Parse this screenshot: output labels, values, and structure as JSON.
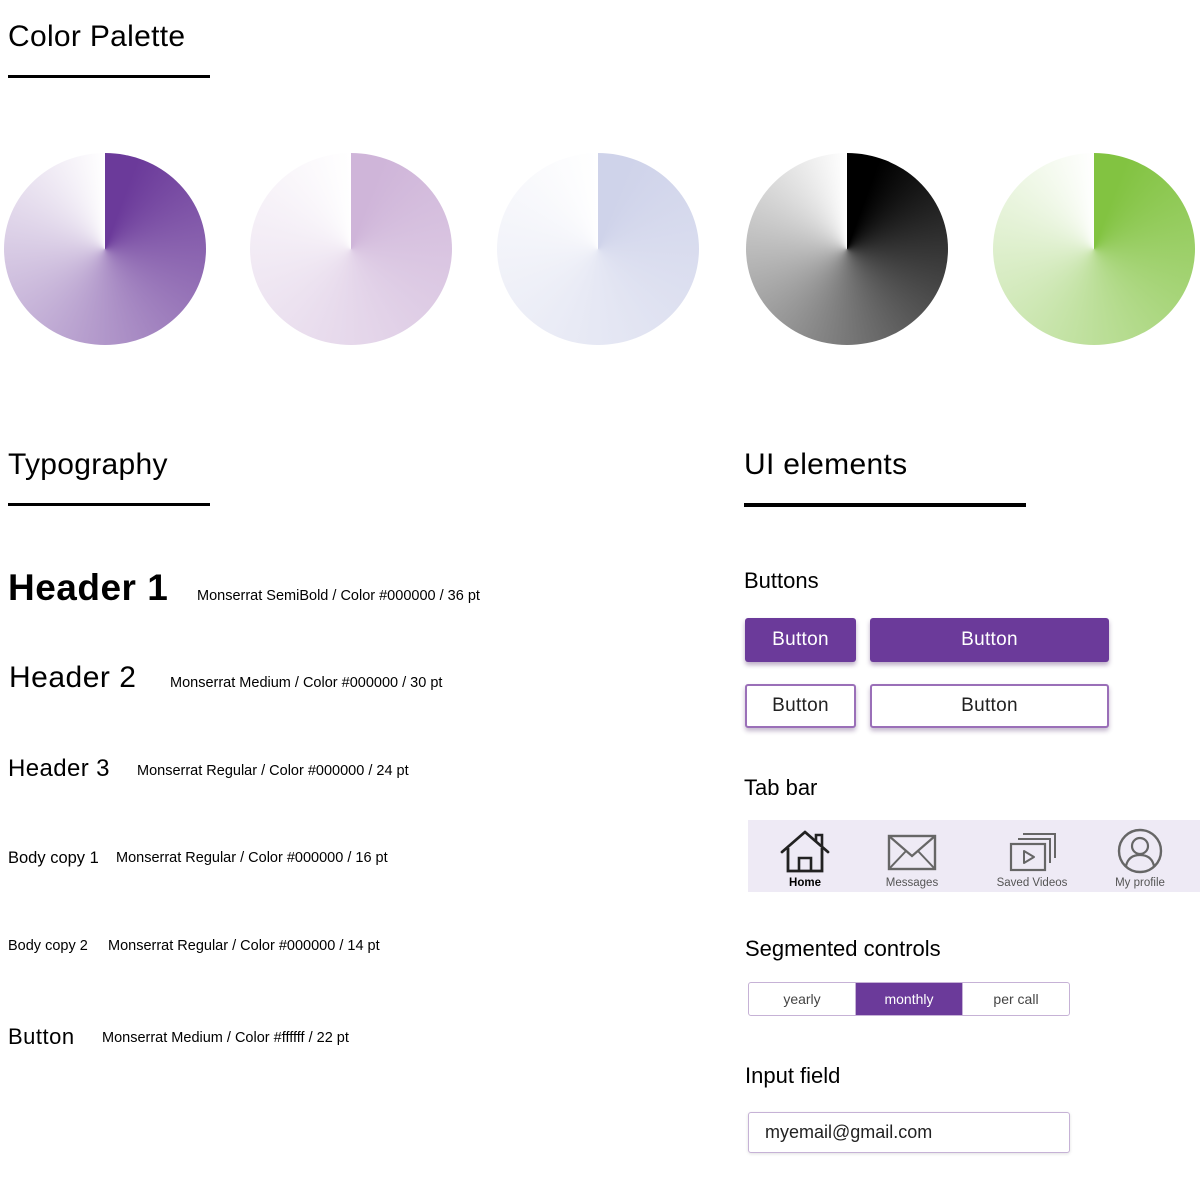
{
  "color_palette": {
    "title": "Color Palette",
    "swatches": [
      {
        "name": "purple",
        "color": "#6b3a9a"
      },
      {
        "name": "lilac",
        "color": "#cfb5d9"
      },
      {
        "name": "lavender",
        "color": "#cfd3ea"
      },
      {
        "name": "black",
        "color": "#000000"
      },
      {
        "name": "green",
        "color": "#82c341"
      }
    ]
  },
  "typography": {
    "title": "Typography",
    "rows": [
      {
        "name": "Header 1",
        "spec": "Monserrat SemiBold / Color #000000 / 36 pt"
      },
      {
        "name": "Header 2",
        "spec": "Monserrat Medium / Color #000000 / 30 pt"
      },
      {
        "name": "Header 3",
        "spec": "Monserrat Regular / Color #000000 / 24 pt"
      },
      {
        "name": "Body copy 1",
        "spec": "Monserrat Regular / Color #000000 / 16 pt"
      },
      {
        "name": "Body copy 2",
        "spec": "Monserrat Regular / Color #000000 / 14 pt"
      },
      {
        "name": "Button",
        "spec": "Monserrat Medium / Color #ffffff / 22 pt"
      }
    ]
  },
  "ui_elements": {
    "title": "UI elements",
    "buttons": {
      "title": "Buttons",
      "filled_small": "Button",
      "filled_large": "Button",
      "outline_small": "Button",
      "outline_large": "Button",
      "primary_color": "#6b3a9a"
    },
    "tab_bar": {
      "title": "Tab bar",
      "tabs": [
        {
          "label": "Home",
          "icon": "home-icon",
          "active": true
        },
        {
          "label": "Messages",
          "icon": "envelope-icon",
          "active": false
        },
        {
          "label": "Saved Videos",
          "icon": "saved-videos-icon",
          "active": false
        },
        {
          "label": "My profile",
          "icon": "profile-icon",
          "active": false
        }
      ]
    },
    "segmented_controls": {
      "title": "Segmented controls",
      "options": [
        "yearly",
        "monthly",
        "per call"
      ],
      "selected": "monthly"
    },
    "input_field": {
      "title": "Input field",
      "value": "myemail@gmail.com"
    }
  }
}
